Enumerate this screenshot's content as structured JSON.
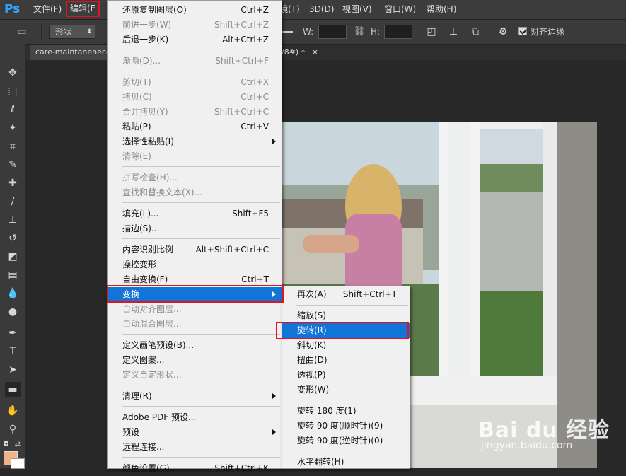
{
  "app": {
    "logo": "Ps"
  },
  "menubar": [
    {
      "label": "文件(F)",
      "key": "file"
    },
    {
      "label": "编辑(E",
      "key": "edit"
    },
    {
      "label": "镜(T)",
      "key": "filter"
    },
    {
      "label": "3D(D)",
      "key": "3d"
    },
    {
      "label": "视图(V)",
      "key": "view"
    },
    {
      "label": "窗口(W)",
      "key": "window"
    },
    {
      "label": "帮助(H)",
      "key": "help"
    }
  ],
  "options": {
    "shape_mode": "形状",
    "w_label": "W:",
    "h_label": "H:",
    "align_edges_label": "对齐边缘",
    "align_edges_checked": true
  },
  "document": {
    "tab_title": "care-maintanenece",
    "tab_suffix": "8/8#) *",
    "close_symbol": "×"
  },
  "edit_menu": [
    {
      "label": "还原复制图层(O)",
      "shortcut": "Ctrl+Z",
      "disabled": false
    },
    {
      "label": "前进一步(W)",
      "shortcut": "Shift+Ctrl+Z",
      "disabled": true
    },
    {
      "label": "后退一步(K)",
      "shortcut": "Alt+Ctrl+Z",
      "disabled": false
    },
    {
      "label": "渐隐(D)...",
      "shortcut": "Shift+Ctrl+F",
      "disabled": true
    },
    {
      "label": "剪切(T)",
      "shortcut": "Ctrl+X",
      "disabled": true
    },
    {
      "label": "拷贝(C)",
      "shortcut": "Ctrl+C",
      "disabled": true
    },
    {
      "label": "合并拷贝(Y)",
      "shortcut": "Shift+Ctrl+C",
      "disabled": true
    },
    {
      "label": "粘贴(P)",
      "shortcut": "Ctrl+V",
      "disabled": false
    },
    {
      "label": "选择性粘贴(I)",
      "shortcut": "",
      "disabled": false,
      "submenu": true
    },
    {
      "label": "清除(E)",
      "shortcut": "",
      "disabled": true
    },
    {
      "label": "拼写检查(H)...",
      "shortcut": "",
      "disabled": true
    },
    {
      "label": "查找和替换文本(X)...",
      "shortcut": "",
      "disabled": true
    },
    {
      "label": "填充(L)...",
      "shortcut": "Shift+F5",
      "disabled": false
    },
    {
      "label": "描边(S)...",
      "shortcut": "",
      "disabled": false
    },
    {
      "label": "内容识别比例",
      "shortcut": "Alt+Shift+Ctrl+C",
      "disabled": false
    },
    {
      "label": "操控变形",
      "shortcut": "",
      "disabled": false
    },
    {
      "label": "自由变换(F)",
      "shortcut": "Ctrl+T",
      "disabled": false
    },
    {
      "label": "变换",
      "shortcut": "",
      "disabled": false,
      "submenu": true,
      "highlighted": true
    },
    {
      "label": "自动对齐图层...",
      "shortcut": "",
      "disabled": true
    },
    {
      "label": "自动混合图层...",
      "shortcut": "",
      "disabled": true
    },
    {
      "label": "定义画笔预设(B)...",
      "shortcut": "",
      "disabled": false
    },
    {
      "label": "定义图案...",
      "shortcut": "",
      "disabled": false
    },
    {
      "label": "定义自定形状...",
      "shortcut": "",
      "disabled": true
    },
    {
      "label": "清理(R)",
      "shortcut": "",
      "disabled": false,
      "submenu": true
    },
    {
      "label": "Adobe PDF 预设...",
      "shortcut": "",
      "disabled": false
    },
    {
      "label": "预设",
      "shortcut": "",
      "disabled": false,
      "submenu": true
    },
    {
      "label": "远程连接...",
      "shortcut": "",
      "disabled": false
    },
    {
      "label": "颜色设置(G)...",
      "shortcut": "Shift+Ctrl+K",
      "disabled": false
    }
  ],
  "transform_menu": [
    {
      "label": "再次(A)",
      "shortcut": "Shift+Ctrl+T",
      "disabled": false
    },
    {
      "label": "缩放(S)",
      "shortcut": "",
      "disabled": false
    },
    {
      "label": "旋转(R)",
      "shortcut": "",
      "disabled": false,
      "highlighted": true
    },
    {
      "label": "斜切(K)",
      "shortcut": "",
      "disabled": false
    },
    {
      "label": "扭曲(D)",
      "shortcut": "",
      "disabled": false
    },
    {
      "label": "透视(P)",
      "shortcut": "",
      "disabled": false
    },
    {
      "label": "变形(W)",
      "shortcut": "",
      "disabled": false
    },
    {
      "label": "旋转 180 度(1)",
      "shortcut": "",
      "disabled": false
    },
    {
      "label": "旋转 90 度(顺时针)(9)",
      "shortcut": "",
      "disabled": false
    },
    {
      "label": "旋转 90 度(逆时针)(0)",
      "shortcut": "",
      "disabled": false
    },
    {
      "label": "水平翻转(H)",
      "shortcut": "",
      "disabled": false
    }
  ],
  "watermark": {
    "brand": "Bai du 经验",
    "url": "jingyan.baidu.com"
  },
  "colors": {
    "menu_highlight": "#1174d8",
    "annotation_red": "#e0141e",
    "foreground": "#f1b48a",
    "background": "#ffffff"
  }
}
